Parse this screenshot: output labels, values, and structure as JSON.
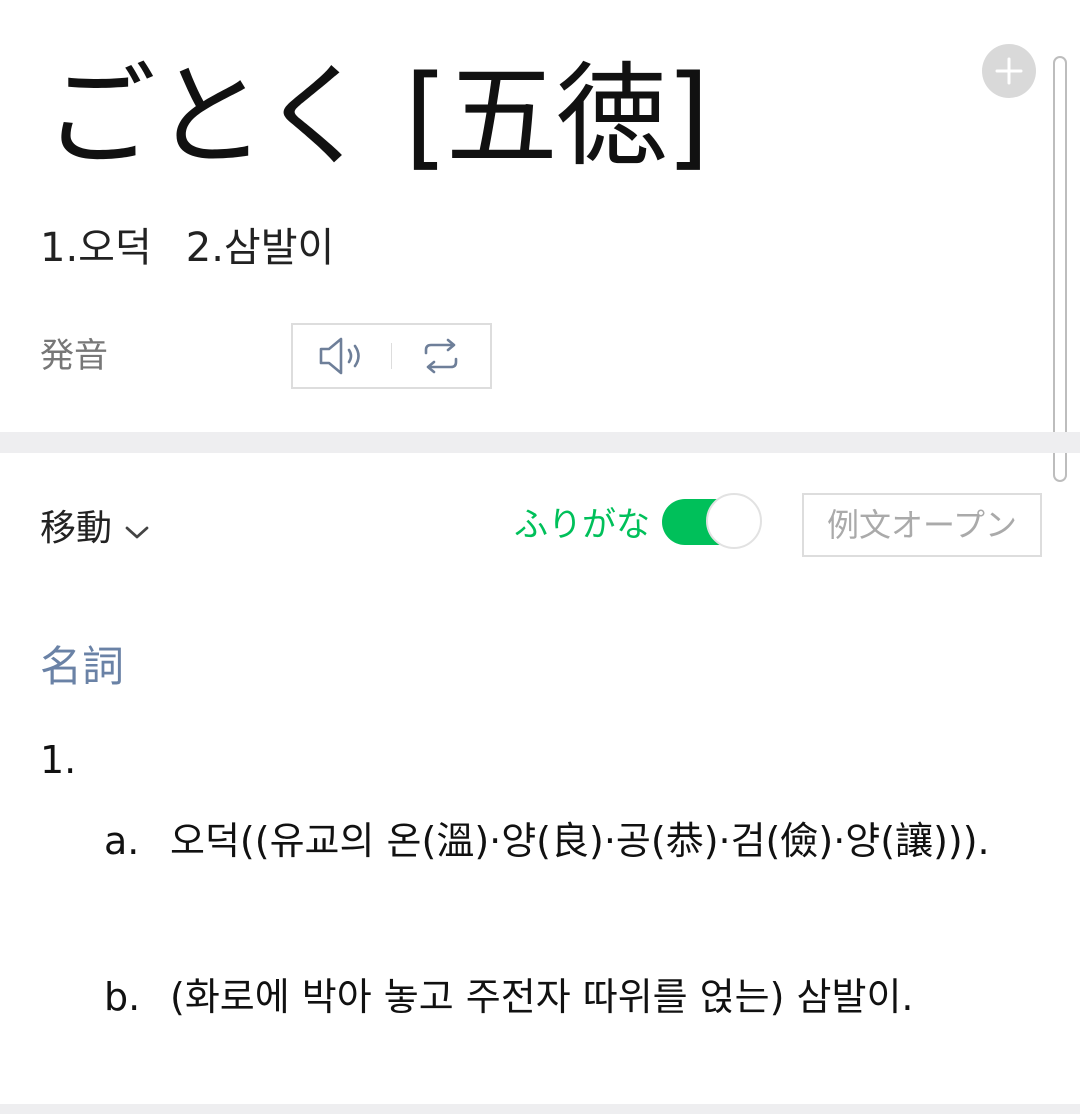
{
  "entry": {
    "headword": "ごとく [五徳]",
    "summary": [
      "1.오덕",
      "2.삼발이"
    ],
    "pronunciation_label": "発音"
  },
  "toolbar": {
    "move_label": "移動",
    "furigana_label": "ふりがな",
    "furigana_on": true,
    "example_button": "例文オープン"
  },
  "senses": {
    "part_of_speech": "名詞",
    "number": "1.",
    "items": [
      {
        "letter": "a.",
        "text": "오덕((유교의 온(溫)·양(良)·공(恭)·검(儉)·양(讓)))."
      },
      {
        "letter": "b.",
        "text": "(화로에 박아 놓고 주전자 따위를 얹는) 삼발이."
      }
    ]
  },
  "icons": {
    "add": "plus-icon",
    "speaker": "speaker-icon",
    "repeat": "repeat-icon",
    "dropdown": "chevron-down-icon"
  },
  "colors": {
    "accent_green": "#00c05a",
    "pos_blue": "#6a82a6",
    "divider": "#eeeef0"
  }
}
